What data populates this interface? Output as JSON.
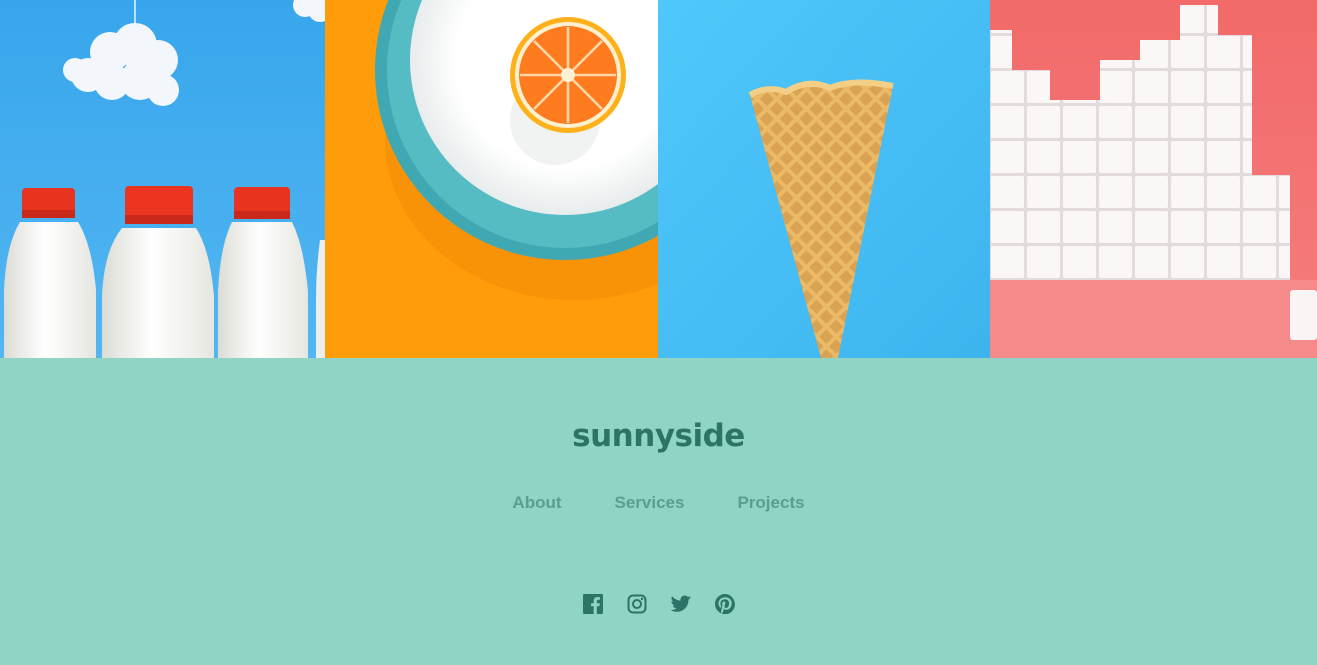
{
  "gallery": {
    "images": [
      {
        "name": "milk-bottles",
        "background": "#3fa9ee"
      },
      {
        "name": "orange-plate",
        "background": "#ff9d0c"
      },
      {
        "name": "waffle-cone",
        "background": "#43bcf4"
      },
      {
        "name": "sugar-cubes",
        "background": "#f26d6d"
      }
    ]
  },
  "footer": {
    "logo": "sunnyside",
    "nav": [
      {
        "label": "About"
      },
      {
        "label": "Services"
      },
      {
        "label": "Projects"
      }
    ],
    "social": [
      {
        "icon": "facebook-icon"
      },
      {
        "icon": "instagram-icon"
      },
      {
        "icon": "twitter-icon"
      },
      {
        "icon": "pinterest-icon"
      }
    ],
    "colors": {
      "background": "#90d4c5",
      "logo": "#2c7566",
      "nav": "#5a9e8f",
      "icons": "#2c7566"
    }
  }
}
